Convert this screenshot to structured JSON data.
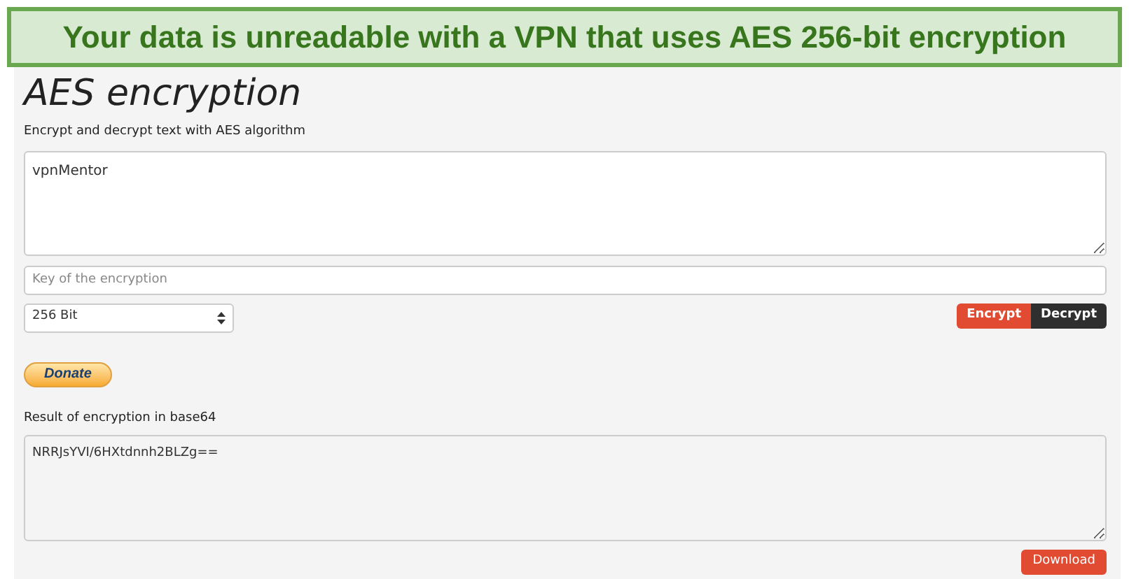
{
  "banner": {
    "text": "Your data is unreadable with a VPN that uses AES 256-bit encryption"
  },
  "title": "AES encryption",
  "subtitle": "Encrypt and decrypt text with AES algorithm",
  "input_text": {
    "value": "vpnMentor"
  },
  "key_field": {
    "placeholder": "Key of the encryption"
  },
  "key_size": {
    "value": "256 Bit"
  },
  "actions": [
    {
      "label": "Encrypt",
      "kind": "primary"
    },
    {
      "label": "Decrypt",
      "kind": "dark"
    }
  ],
  "donate": {
    "label": "Donate"
  },
  "result_label": "Result of encryption in base64",
  "result": {
    "value": "NRRJsYVI/6HXtdnnh2BLZg=="
  },
  "download": {
    "label": "Download"
  }
}
